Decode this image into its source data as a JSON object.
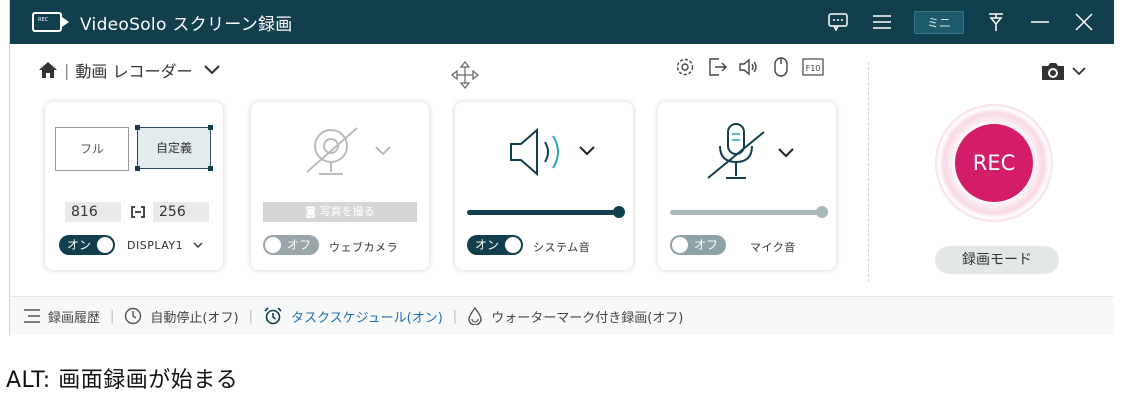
{
  "window": {
    "app_title": "VideoSolo スクリーン録画",
    "mini_label": "ミニ",
    "logo_text": "REC"
  },
  "toolbar": {
    "mode_label": "動画 レコーダー"
  },
  "cards": {
    "display": {
      "full_label": "フル",
      "custom_label": "自定義",
      "width": "816",
      "height": "256",
      "toggle_label": "オン",
      "display_name": "DISPLAY1"
    },
    "webcam": {
      "photo_label": "写真を撮る",
      "toggle_label": "オフ",
      "name": "ウェブカメラ"
    },
    "system_audio": {
      "toggle_label": "オン",
      "name": "システム音",
      "volume": 1.0
    },
    "microphone": {
      "toggle_label": "オフ",
      "name": "マイク音",
      "volume": 1.0
    }
  },
  "rec": {
    "button_label": "REC",
    "mode_button": "録画モード"
  },
  "bottom": {
    "history": "録画履歴",
    "auto_stop": "自動停止(オフ)",
    "schedule": "タスクスケジュール(オン)",
    "watermark": "ウォーターマーク付き録画(オフ)"
  },
  "caption": "ALT: 画面録画が始まる",
  "colors": {
    "titlebar": "#123f4d",
    "accent": "#123f4d",
    "rec": "#d31d68",
    "schedule_blue": "#1f6fb5"
  }
}
